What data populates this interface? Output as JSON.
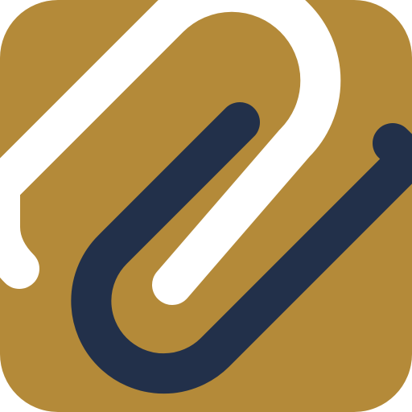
{
  "app_icon": {
    "name": "paperclip-app-icon",
    "colors": {
      "background": "#B48A39",
      "clip_front": "#FFFFFF",
      "clip_back": "#22304A",
      "page": "#FFFFFF"
    }
  }
}
